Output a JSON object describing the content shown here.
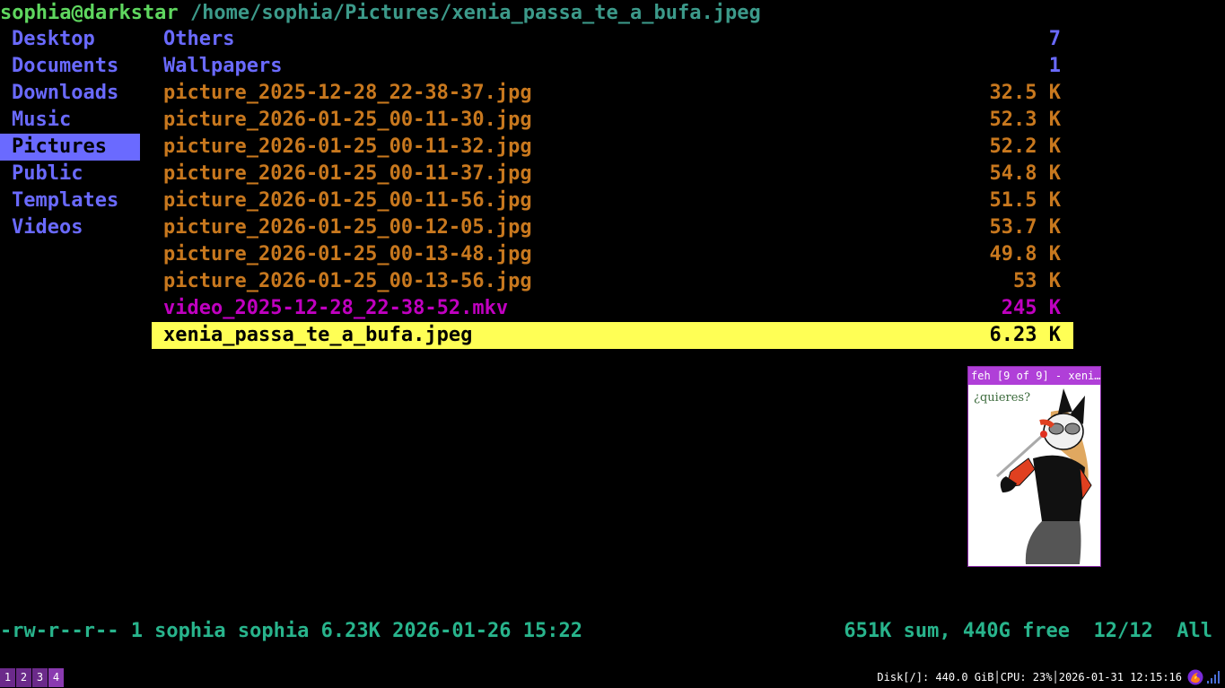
{
  "title": {
    "host": "sophia@darkstar",
    "path": "/home/sophia/Pictures/xenia_passa_te_a_bufa.jpeg"
  },
  "sidebar": {
    "items": [
      {
        "label": "Desktop",
        "selected": false
      },
      {
        "label": "Documents",
        "selected": false
      },
      {
        "label": "Downloads",
        "selected": false
      },
      {
        "label": "Music",
        "selected": false
      },
      {
        "label": "Pictures",
        "selected": true
      },
      {
        "label": "Public",
        "selected": false
      },
      {
        "label": "Templates",
        "selected": false
      },
      {
        "label": "Videos",
        "selected": false
      }
    ]
  },
  "files": [
    {
      "name": "Others",
      "size": "7",
      "kind": "dir"
    },
    {
      "name": "Wallpapers",
      "size": "1",
      "kind": "dir"
    },
    {
      "name": "picture_2025-12-28_22-38-37.jpg",
      "size": "32.5 K",
      "kind": "img"
    },
    {
      "name": "picture_2026-01-25_00-11-30.jpg",
      "size": "52.3 K",
      "kind": "img"
    },
    {
      "name": "picture_2026-01-25_00-11-32.jpg",
      "size": "52.2 K",
      "kind": "img"
    },
    {
      "name": "picture_2026-01-25_00-11-37.jpg",
      "size": "54.8 K",
      "kind": "img"
    },
    {
      "name": "picture_2026-01-25_00-11-56.jpg",
      "size": "51.5 K",
      "kind": "img"
    },
    {
      "name": "picture_2026-01-25_00-12-05.jpg",
      "size": "53.7 K",
      "kind": "img"
    },
    {
      "name": "picture_2026-01-25_00-13-48.jpg",
      "size": "49.8 K",
      "kind": "img"
    },
    {
      "name": "picture_2026-01-25_00-13-56.jpg",
      "size": "53 K",
      "kind": "img"
    },
    {
      "name": "video_2025-12-28_22-38-52.mkv",
      "size": "245 K",
      "kind": "vid"
    },
    {
      "name": "xenia_passa_te_a_bufa.jpeg",
      "size": "6.23 K",
      "kind": "img",
      "selected": true
    }
  ],
  "preview": {
    "window_title": "feh [9 of 9] - xeni…",
    "caption": "¿quieres?"
  },
  "status": {
    "left": "-rw-r--r-- 1 sophia sophia 6.23K 2026-01-26 15:22",
    "right": "651K sum, 440G free  12/12  All"
  },
  "bar": {
    "workspaces": [
      "1",
      "2",
      "3",
      "4"
    ],
    "disk": "Disk[/]: 440.0 GiB",
    "cpu": "CPU: 23%",
    "datetime": "2026-01-31 12:15:16",
    "icons": [
      "firefox-icon",
      "network-signal-icon"
    ]
  },
  "colors": {
    "host": "#5fd75f",
    "path": "#3c9a8a",
    "directory": "#6a6aff",
    "image_file": "#c8781e",
    "video_file": "#c000c0",
    "selection": "#ffff55",
    "status": "#28b48c",
    "workspace": "#6b2a8a"
  }
}
